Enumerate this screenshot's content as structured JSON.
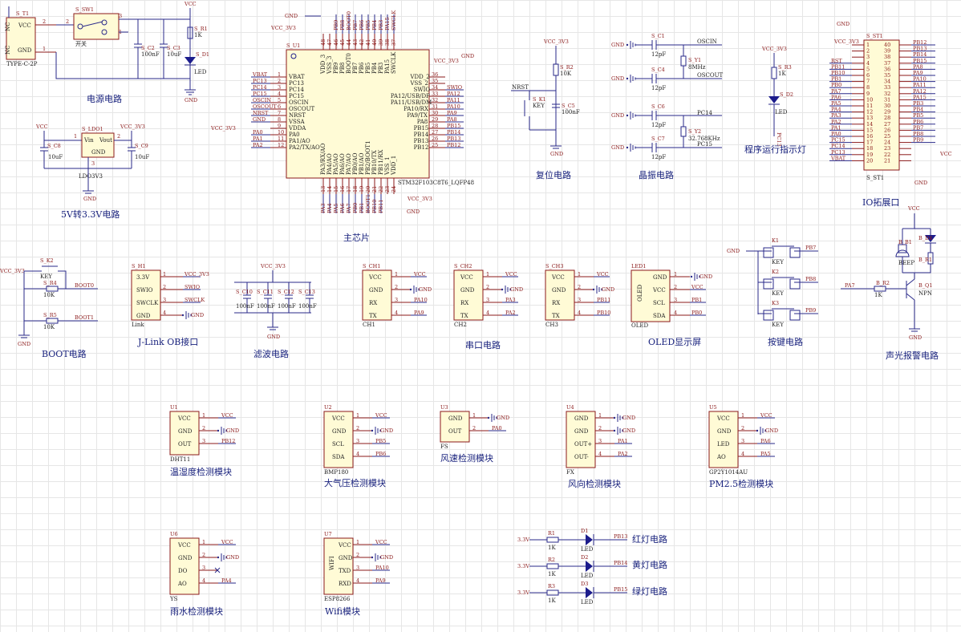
{
  "sections": {
    "power": "电源电路",
    "ldo": "5V转3.3V电路",
    "mcu": "主芯片",
    "reset": "复位电路",
    "crystal": "晶振电路",
    "indicator": "程序运行指示灯",
    "io": "IO拓展口",
    "boot": "BOOT电路",
    "jlink": "J-Link OB接口",
    "filter": "滤波电路",
    "serial": "串口电路",
    "oled": "OLED显示屏",
    "keys": "按键电路",
    "alarm": "声光报警电路",
    "dht": "温湿度检测模块",
    "bmp": "大气压检测模块",
    "fs": "风速检测模块",
    "fx": "风向检测模块",
    "pm": "PM2.5检测模块",
    "rain": "雨水检测模块",
    "wifi": "Wifi模块",
    "red": "红灯电路",
    "yellow": "黄灯电路",
    "green": "绿灯电路"
  },
  "nets": {
    "vcc": "VCC",
    "vcc33": "VCC_3V3",
    "gnd": "GND",
    "v33": "3.3V"
  },
  "usb": {
    "ref": "S_T1",
    "part": "TYPE-C-2P",
    "p1": "NC",
    "p2": "VCC",
    "p3": "NC",
    "p4": "GND",
    "n1": "1",
    "n2": "2"
  },
  "sw1": {
    "ref": "S_SW1",
    "note": "开关",
    "n1": "1",
    "n2": "2",
    "n3": "3"
  },
  "power_parts": {
    "c2": "S_C2",
    "c2v": "100nF",
    "c3": "S_C3",
    "c3v": "10uF",
    "r1": "S_R1",
    "r1v": "1K",
    "d1": "S_D1",
    "d1v": "LED"
  },
  "ldo": {
    "ref": "S_LDO1",
    "part": "LDO3V3",
    "vin": "Vin",
    "vout": "Vout",
    "gnd": "GND",
    "c8": "S_C8",
    "c8v": "10uF",
    "c9": "S_C9",
    "c9v": "10uF",
    "n1": "1",
    "n2": "2",
    "n3": "3"
  },
  "mcu": {
    "ref": "S_U1",
    "part": "STM32F103C8T6_LQFP48",
    "left": [
      {
        "n": "1",
        "name": "VBAT",
        "net": "VBAT"
      },
      {
        "n": "2",
        "name": "PC13",
        "net": "PC13"
      },
      {
        "n": "3",
        "name": "PC14",
        "net": "PC14"
      },
      {
        "n": "4",
        "name": "PC15",
        "net": "PC15"
      },
      {
        "n": "5",
        "name": "OSCIN",
        "net": "OSCIN"
      },
      {
        "n": "6",
        "name": "OSCOUT",
        "net": "OSCOUT"
      },
      {
        "n": "7",
        "name": "NRST",
        "net": "NRST"
      },
      {
        "n": "8",
        "name": "VSSA",
        "net": "GND"
      },
      {
        "n": "9",
        "name": "VDDA",
        "net": ""
      },
      {
        "n": "10",
        "name": "PA0",
        "net": "PA0"
      },
      {
        "n": "11",
        "name": "PA1/AO",
        "net": "PA1"
      },
      {
        "n": "12",
        "name": "PA2/TX/AO",
        "net": "PA2"
      }
    ],
    "right": [
      {
        "n": "36",
        "name": "VDD_2",
        "net": ""
      },
      {
        "n": "35",
        "name": "VSS_2",
        "net": ""
      },
      {
        "n": "34",
        "name": "SWIO",
        "net": "SWIO"
      },
      {
        "n": "33",
        "name": "PA12/USB/DP",
        "net": "PA12"
      },
      {
        "n": "32",
        "name": "PA11/USB/DM",
        "net": "PA11"
      },
      {
        "n": "31",
        "name": "PA10/RX",
        "net": "PA10"
      },
      {
        "n": "30",
        "name": "PA9/TX",
        "net": "PA9"
      },
      {
        "n": "29",
        "name": "PA8",
        "net": "PA8"
      },
      {
        "n": "28",
        "name": "PB15",
        "net": "PB15"
      },
      {
        "n": "27",
        "name": "PB14",
        "net": "PB14"
      },
      {
        "n": "26",
        "name": "PB13",
        "net": "PB13"
      },
      {
        "n": "25",
        "name": "PB12",
        "net": "PB12"
      }
    ],
    "top": [
      {
        "n": "48",
        "name": "VDD_3",
        "net": ""
      },
      {
        "n": "47",
        "name": "VSS_3",
        "net": ""
      },
      {
        "n": "46",
        "name": "PB9",
        "net": "PB9"
      },
      {
        "n": "45",
        "name": "PB8",
        "net": "PB8"
      },
      {
        "n": "44",
        "name": "BOOT0",
        "net": "BOOT0"
      },
      {
        "n": "43",
        "name": "PB7",
        "net": "PB7"
      },
      {
        "n": "42",
        "name": "PB6",
        "net": "PB6"
      },
      {
        "n": "41",
        "name": "PB5",
        "net": "PB5"
      },
      {
        "n": "40",
        "name": "PB4",
        "net": "PB4"
      },
      {
        "n": "39",
        "name": "PB3",
        "net": "PB3"
      },
      {
        "n": "38",
        "name": "PA15",
        "net": "PA15"
      },
      {
        "n": "37",
        "name": "SWCLK",
        "net": "SWCLK"
      }
    ],
    "bottom": [
      {
        "n": "13",
        "name": "PA3/RX/AO",
        "net": "PA3"
      },
      {
        "n": "14",
        "name": "PA4/AO",
        "net": "PA4"
      },
      {
        "n": "15",
        "name": "PA5/AO",
        "net": "PA5"
      },
      {
        "n": "16",
        "name": "PA6/AO",
        "net": "PA6"
      },
      {
        "n": "17",
        "name": "PA7/AO",
        "net": "PA7"
      },
      {
        "n": "18",
        "name": "PB0/AO",
        "net": "PB0"
      },
      {
        "n": "19",
        "name": "PB1/AO",
        "net": "PB1"
      },
      {
        "n": "20",
        "name": "PB2/BOOT1",
        "net": "BOOT1"
      },
      {
        "n": "21",
        "name": "PB10/TX",
        "net": "PB10"
      },
      {
        "n": "22",
        "name": "PB11/RX",
        "net": "PB11"
      },
      {
        "n": "23",
        "name": "VSS_1",
        "net": ""
      },
      {
        "n": "24",
        "name": "VDD_1",
        "net": ""
      }
    ]
  },
  "reset": {
    "r2": "S_R2",
    "r2v": "10K",
    "k1": "S_K1",
    "k1v": "KEY",
    "c5": "S_C5",
    "c5v": "100nF",
    "nrst": "NRST"
  },
  "crystal": {
    "c1": "S_C1",
    "c4": "S_C4",
    "c6": "S_C6",
    "c7": "S_C7",
    "cv": "12pF",
    "y1": "S_Y1",
    "y1v": "8MHz",
    "y2": "S_Y2",
    "y2v": "32.768KHz",
    "oscin": "OSCIN",
    "oscout": "OSCOUT",
    "pc14": "PC14",
    "pc15": "PC15"
  },
  "indicator": {
    "r3": "S_R3",
    "r3v": "1K",
    "d2": "S_D2",
    "d2v": "LED",
    "net": "PC13"
  },
  "io": {
    "ref": "S_ST1",
    "left": [
      "",
      "",
      "RST",
      "PB11",
      "PB10",
      "PB1",
      "PB0",
      "PA7",
      "PA6",
      "PA5",
      "PA4",
      "PA3",
      "PA2",
      "PA1",
      "PA0",
      "PC15",
      "PC14",
      "PC13",
      "VBAT"
    ],
    "right": [
      "PB12",
      "PB13",
      "PB14",
      "PB15",
      "PA8",
      "PA9",
      "PA10",
      "PA11",
      "PA12",
      "PA15",
      "PB3",
      "PB4",
      "PB5",
      "PB6",
      "PB7",
      "PB8",
      "PB9",
      "",
      "",
      ""
    ]
  },
  "boot": {
    "k2": "S_K2",
    "k2v": "KEY",
    "r4": "S_R4",
    "r4v": "10K",
    "r5": "S_R5",
    "r5v": "10K",
    "b0": "BOOT0",
    "b1": "BOOT1"
  },
  "jlink": {
    "ref": "S_H1",
    "part": "Link",
    "pins": [
      "3.3V",
      "SWIO",
      "SWCLK",
      "GND"
    ],
    "nets": [
      "VCC_3V3",
      "SWIO",
      "SWCLK",
      "GND"
    ]
  },
  "filter": {
    "caps": [
      "S_C10",
      "S_C11",
      "S_C12",
      "S_C13"
    ],
    "v": "100nF"
  },
  "serial": [
    {
      "ref": "S_CH1",
      "part": "CH1",
      "rx": "PA10",
      "tx": "PA9"
    },
    {
      "ref": "S_CH2",
      "part": "CH2",
      "rx": "PA3",
      "tx": "PA2"
    },
    {
      "ref": "S_CH3",
      "part": "CH3",
      "rx": "PB11",
      "tx": "PB10"
    }
  ],
  "serial_pins": [
    "VCC",
    "GND",
    "RX",
    "TX"
  ],
  "oled": {
    "ref": "LED1",
    "part": "OLED",
    "body": "OLED",
    "pins": [
      "GND",
      "VCC",
      "SCL",
      "SDA"
    ],
    "nets": [
      "GND",
      "VCC",
      "PB1",
      "PB0"
    ]
  },
  "keys": [
    {
      "ref": "K1",
      "v": "KEY",
      "net": "PB7"
    },
    {
      "ref": "K2",
      "v": "KEY",
      "net": "PB8"
    },
    {
      "ref": "K3",
      "v": "KEY",
      "net": "PB9"
    }
  ],
  "alarm": {
    "b1": "B_B1",
    "b1v": "BEEP",
    "d4": "B_D4",
    "r1": "B_R1",
    "r2": "B_R2",
    "r2v": "1K",
    "q1": "B_Q1",
    "q1v": "NPN",
    "net": "PA7"
  },
  "modules": {
    "dht": {
      "ref": "U1",
      "part": "DHT11",
      "pins": [
        "VCC",
        "GND",
        "OUT"
      ],
      "nets": [
        "VCC",
        "GND",
        "PB12"
      ]
    },
    "bmp": {
      "ref": "U2",
      "part": "BMP180",
      "pins": [
        "VCC",
        "GND",
        "SCL",
        "SDA"
      ],
      "nets": [
        "VCC",
        "GND",
        "PB5",
        "PB6"
      ]
    },
    "fs": {
      "ref": "U3",
      "part": "FS",
      "pins": [
        "GND",
        "OUT"
      ],
      "nets": [
        "GND",
        "PA0"
      ]
    },
    "fx": {
      "ref": "U4",
      "part": "FX",
      "pins": [
        "GND",
        "GND",
        "OUT+",
        "OUT-"
      ],
      "nets": [
        "GND",
        "GND",
        "PA1",
        "PA2"
      ]
    },
    "pm": {
      "ref": "U5",
      "part": "GP2Y1014AU",
      "pins": [
        "VCC",
        "GND",
        "LED",
        "AO"
      ],
      "nets": [
        "VCC",
        "GND",
        "PA6",
        "PA5"
      ]
    },
    "rain": {
      "ref": "U6",
      "part": "YS",
      "pins": [
        "VCC",
        "GND",
        "DO",
        "AO"
      ],
      "nets": [
        "VCC",
        "GND",
        "",
        "PA4"
      ]
    },
    "wifi": {
      "ref": "U7",
      "part": "ESP8266",
      "body": "WIFI",
      "pins": [
        "VCC",
        "GND",
        "TXD",
        "RXD"
      ],
      "nets": [
        "VCC",
        "GND",
        "PA10",
        "PA9"
      ]
    }
  },
  "leds": [
    {
      "r": "R1",
      "rv": "1K",
      "d": "D1",
      "dv": "LED",
      "net": "PB13"
    },
    {
      "r": "R2",
      "rv": "1K",
      "d": "D2",
      "dv": "LED",
      "net": "PB14"
    },
    {
      "r": "R3",
      "rv": "1K",
      "d": "D3",
      "dv": "LED",
      "net": "PB15"
    }
  ]
}
